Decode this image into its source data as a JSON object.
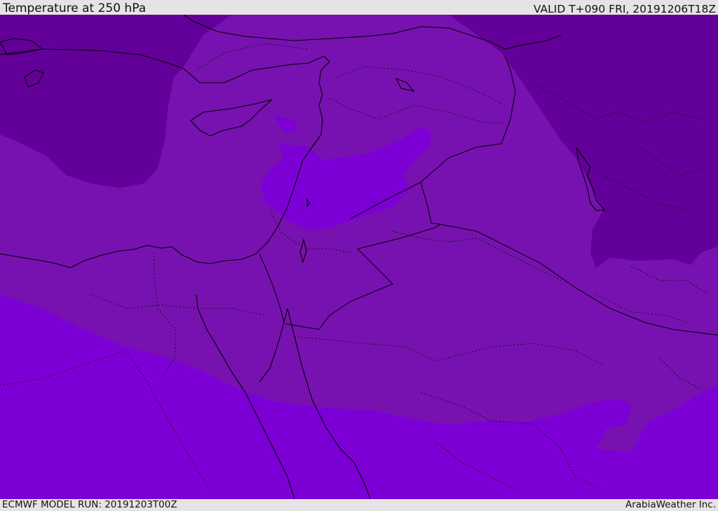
{
  "header": {
    "title": "Temperature at 250 hPa",
    "valid_time": "VALID T+090 FRI, 20191206T18Z"
  },
  "footer": {
    "model_run": "ECMWF MODEL RUN: 20191203T00Z",
    "credit": "ArabiaWeather Inc."
  },
  "map": {
    "colors": {
      "band_cold": "#630099",
      "band_mid": "#7712b0",
      "band_warm": "#7c00d6",
      "coastline": "#000000",
      "border": "#111111"
    }
  }
}
